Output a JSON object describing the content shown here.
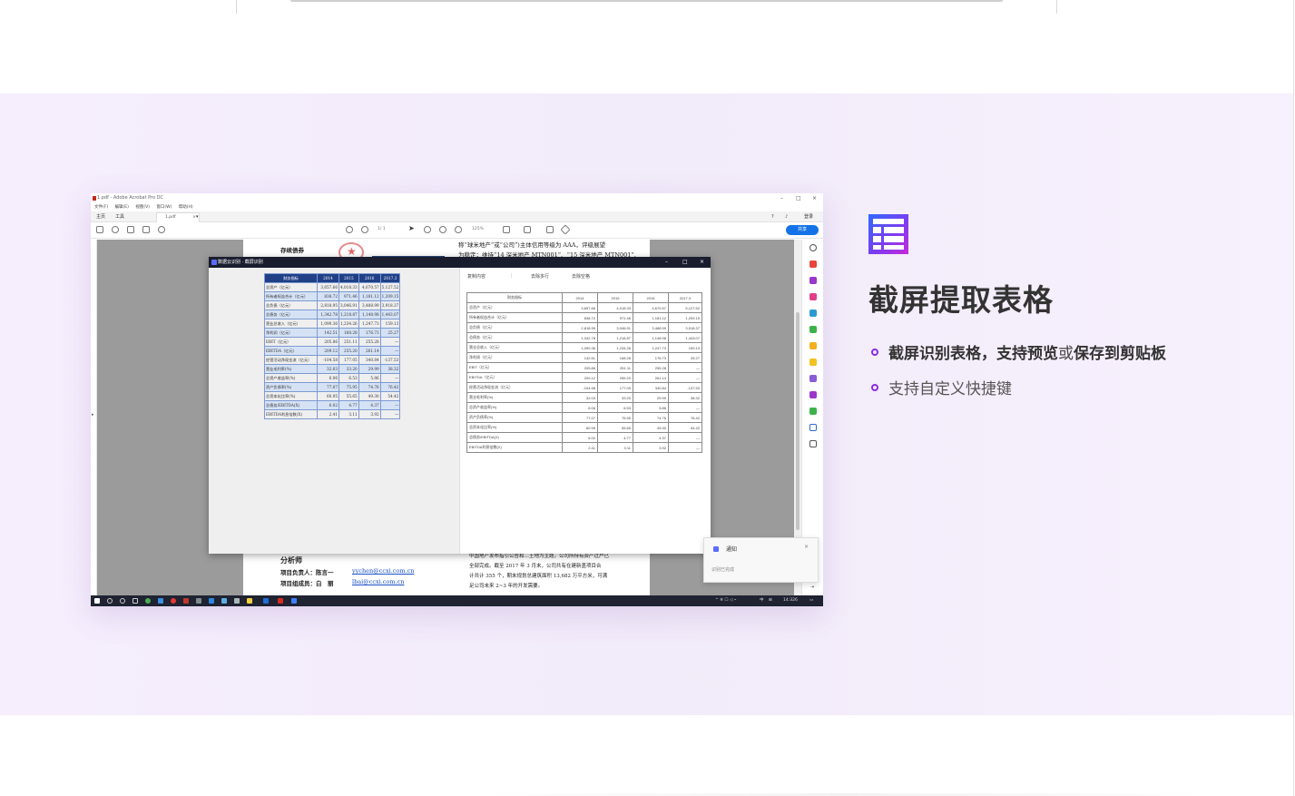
{
  "feature": {
    "title": "截屏提取表格",
    "bullet1_a": "截屏识别表格，支持预览",
    "bullet1_b": "或",
    "bullet1_c": "保存到剪贴板",
    "bullet2": "支持自定义快捷键",
    "icon": "table-icon",
    "accent": "#8a2be2"
  },
  "app": {
    "title": "1.pdf - Adobe Acrobat Pro DC",
    "menu": [
      "文件(F)",
      "编辑(E)",
      "视图(V)",
      "窗口(W)",
      "帮助(H)"
    ],
    "tab_home": "主页",
    "tab_tools": "工具",
    "doc_tab": "1.pdf",
    "page_info": "/ 1",
    "zoom": "125%",
    "login": "登录",
    "share": "共享"
  },
  "pdf": {
    "line1": "称“球米地产”或“公司”)主体信用等级为 AAA，评级展望",
    "line2": "为稳定；维持“14 深米地产 MTN001”、“15 深米地产 MTN001”、",
    "heading": "存续债券",
    "analyst_heading": "分析师",
    "lead_label": "项目负责人：陈言一",
    "lead_email": "yychen@ccxi.com.cn",
    "member_label": "项目组成员：白　丽",
    "member_email": "lbai@ccxi.com.cn",
    "body1": "中国地产发布指引公告和…土地为主题，公司所持有资产过户已",
    "body2": "全部完成。截至 2017 年 3 月末，公司共有在建新盖项目合",
    "body3": "计共计 355 个，期末规划总建筑面积 13,682 万平方米，可满",
    "body4": "足公司未来 2~3 年的开发需要。"
  },
  "rec_window": {
    "title": "数据云识别 · 截屏识别",
    "tab_copy": "复制内容",
    "tab_merge": "去除多行",
    "tab_format": "去除空格"
  },
  "table": {
    "headers": [
      "财务指标",
      "2014",
      "2015",
      "2016",
      "2017.3"
    ],
    "src_header0": "财务指标",
    "rows": [
      [
        "总资产（亿元）",
        "3,657.66",
        "4,018.33",
        "4,670.57",
        "5,127.52"
      ],
      [
        "所有者权益合计（亿元）",
        "838.72",
        "971.46",
        "1,181.12",
        "1,209.15"
      ],
      [
        "总负债（亿元）",
        "2,818.95",
        "3,046.91",
        "3,488.99",
        "3,918.37"
      ],
      [
        "总债务（亿元）",
        "1,342.78",
        "1,218.87",
        "1,148.98",
        "1,443.07"
      ],
      [
        "营业总收入（亿元）",
        "1,090.36",
        "1,234.26",
        "1,247.73",
        "159.13"
      ],
      [
        "净利润（亿元）",
        "142.51",
        "168.28",
        "176.73",
        "25.27"
      ],
      [
        "EBIT（亿元）",
        "205.86",
        "251.11",
        "255.28",
        "—"
      ],
      [
        "EBITDA（亿元）",
        "209.12",
        "255.20",
        "261.14",
        "—"
      ],
      [
        "经营活动净现金流（亿元）",
        "-104.58",
        "177.05",
        "340.84",
        "-137.53"
      ],
      [
        "营业毛利率(%)",
        "32.03",
        "33.20",
        "29.99",
        "38.32"
      ],
      [
        "总资产收益率(%)",
        "6.06",
        "6.53",
        "5.86",
        "—"
      ],
      [
        "资产负债率(%)",
        "77.07",
        "75.95",
        "74.76",
        "76.42"
      ],
      [
        "总资本化比率(%)",
        "60.95",
        "55.65",
        "49.30",
        "54.42"
      ],
      [
        "总债务/EBITDA(X)",
        "6.02",
        "4.77",
        "4.37",
        "—"
      ],
      [
        "EBITDA利息倍数(X)",
        "2.41",
        "3.11",
        "3.92",
        "—"
      ]
    ]
  },
  "toast": {
    "title": "通知",
    "message": "识别已完成",
    "close": "×"
  },
  "taskbar": {
    "ime": "中",
    "time": "14:326"
  }
}
